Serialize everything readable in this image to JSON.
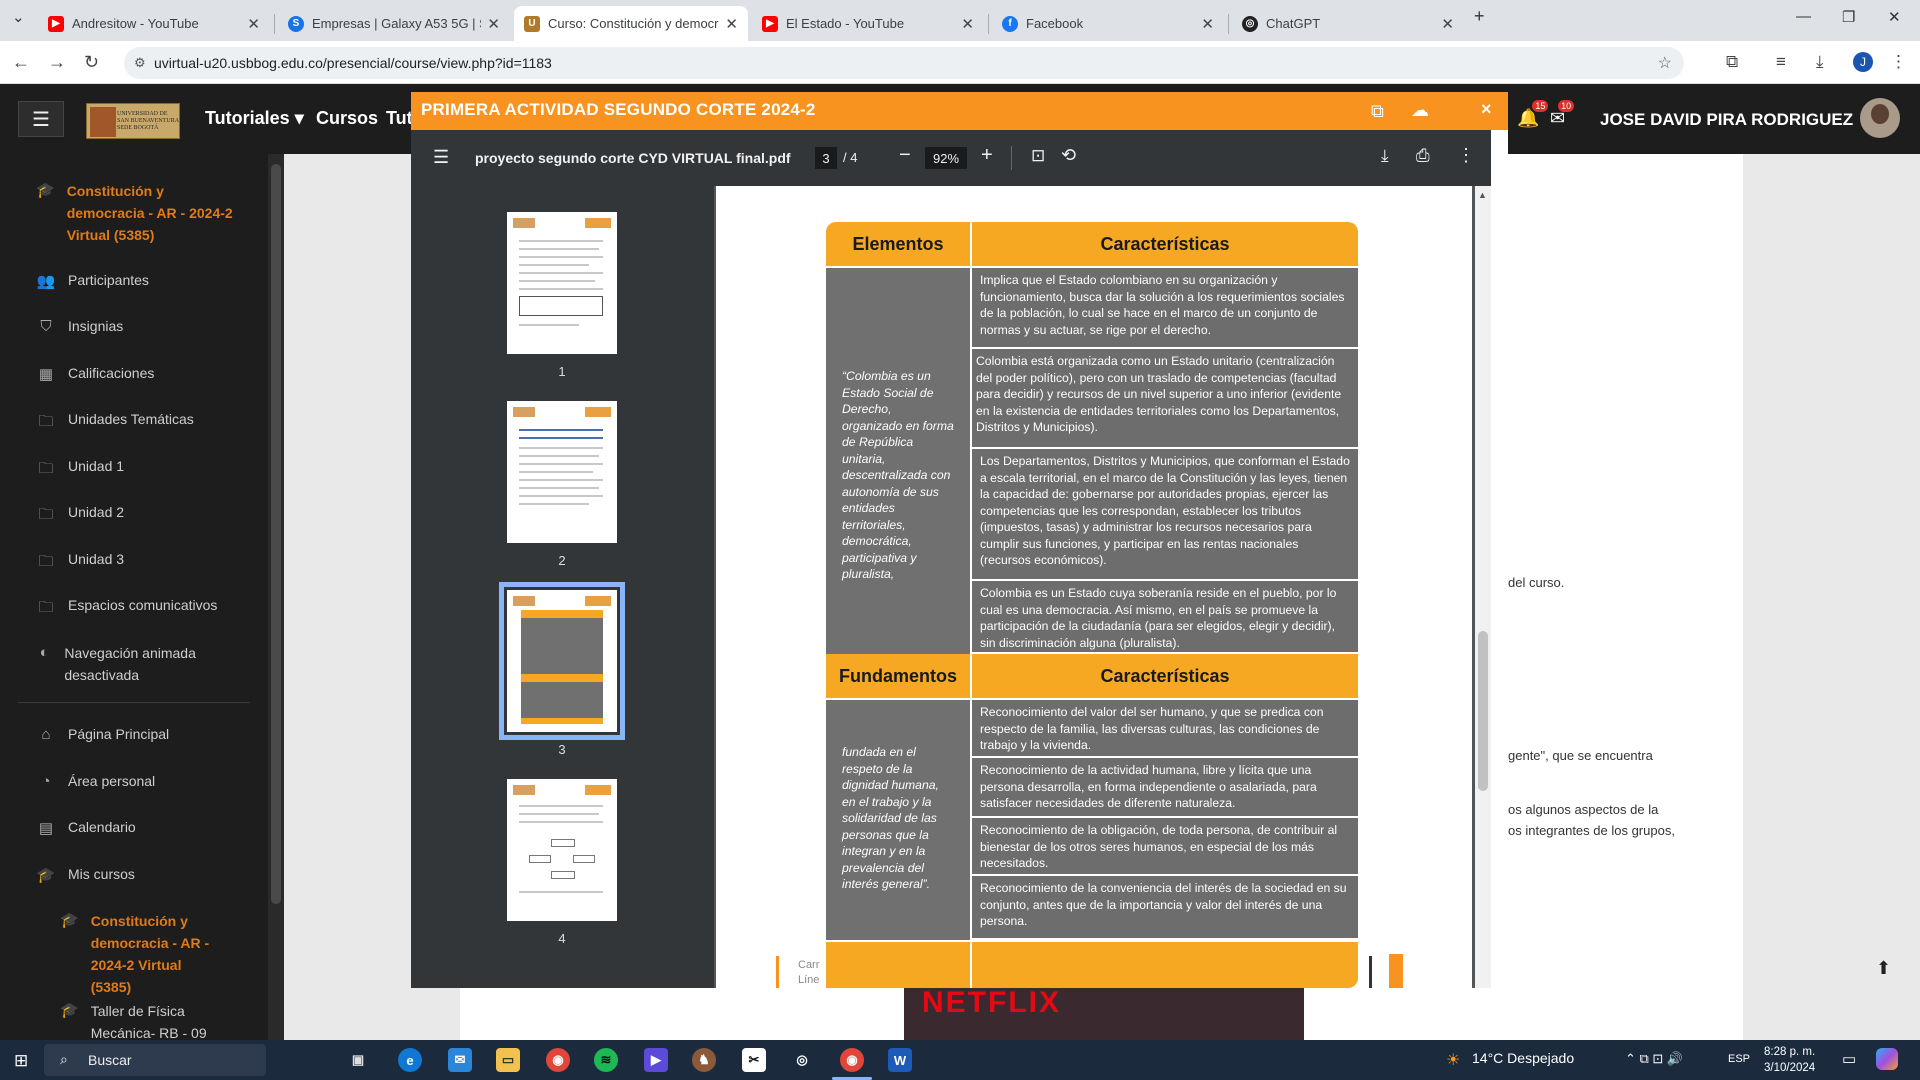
{
  "browser": {
    "tabs": [
      {
        "title": "Andresitow - YouTube",
        "favicon": "youtube-icon",
        "active": false
      },
      {
        "title": "Empresas | Galaxy A53 5G | SM-",
        "favicon": "samsung-icon",
        "active": false
      },
      {
        "title": "Curso: Constitución y democrac",
        "favicon": "usb-icon",
        "active": true
      },
      {
        "title": "El Estado - YouTube",
        "favicon": "youtube-icon",
        "active": false
      },
      {
        "title": "Facebook",
        "favicon": "facebook-icon",
        "active": false
      },
      {
        "title": "ChatGPT",
        "favicon": "chatgpt-icon",
        "active": false
      }
    ],
    "url": "uvirtual-u20.usbbog.edu.co/presencial/course/view.php?id=1183",
    "profile_initial": "J"
  },
  "site": {
    "logo_text": "UNIVERSIDAD DE SAN BUENAVENTURA SEDE BOGOTÁ",
    "nav": [
      "Tutoriales",
      "Cursos",
      "Tut"
    ],
    "notifications_count": "15",
    "messages_count": "10",
    "user_name": "JOSE DAVID PIRA RODRIGUEZ"
  },
  "sidebar": {
    "course_title": "Constitución y democracia - AR - 2024-2 Virtual (5385)",
    "items": [
      {
        "label": "Participantes",
        "icon": "users-icon"
      },
      {
        "label": "Insignias",
        "icon": "shield-icon"
      },
      {
        "label": "Calificaciones",
        "icon": "table-icon"
      },
      {
        "label": "Unidades Temáticas",
        "icon": "folder-icon"
      },
      {
        "label": "Unidad 1",
        "icon": "folder-icon"
      },
      {
        "label": "Unidad 2",
        "icon": "folder-icon"
      },
      {
        "label": "Unidad 3",
        "icon": "folder-icon"
      },
      {
        "label": "Espacios comunicativos",
        "icon": "folder-icon"
      },
      {
        "label": "Navegación animada desactivada",
        "icon": "toggle-icon"
      },
      {
        "label": "Página Principal",
        "icon": "home-icon"
      },
      {
        "label": "Área personal",
        "icon": "dashboard-icon"
      },
      {
        "label": "Calendario",
        "icon": "calendar-icon"
      },
      {
        "label": "Mis cursos",
        "icon": "graduation-cap-icon"
      }
    ],
    "my_courses": [
      {
        "label": "Constitución y democracia - AR - 2024-2 Virtual (5385)"
      },
      {
        "label": "Taller de Física Mecánica- RB - 09"
      }
    ]
  },
  "background": {
    "text1": "del curso.",
    "text2": "gente\", que se  encuentra",
    "text3": "os algunos aspectos de la",
    "text4": "os integrantes de los grupos,",
    "banner": "NETFLIX"
  },
  "modal": {
    "title": "PRIMERA ACTIVIDAD SEGUNDO CORTE 2024-2",
    "close": "×"
  },
  "pdf": {
    "filename": "proyecto segundo corte CYD VIRTUAL final.pdf",
    "current_page": "3",
    "page_of": "/   4",
    "zoom": "92%",
    "thumbnails": [
      "1",
      "2",
      "3",
      "4"
    ],
    "selected_page": 3
  },
  "document": {
    "header1_left": "Elementos",
    "header1_right": "Características",
    "quote1": "“Colombia es un Estado Social de Derecho, organizado en forma de República unitaria, descentralizada con autonomía de sus entidades territoriales, democrática, participativa y pluralista,",
    "rows1": [
      "Implica que el Estado colombiano en su organización y funcionamiento,  busca dar la solución a los requerimientos sociales de la población, lo cual se hace en el marco de un conjunto de normas y su actuar, se rige por el derecho.",
      "Colombia está organizada como un Estado unitario (centralización del poder político), pero con un traslado de competencias (facultad para decidir) y recursos de un nivel superior a uno inferior (evidente en la existencia de entidades territoriales como los Departamentos, Distritos y Municipios).",
      "Los Departamentos, Distritos y Municipios, que conforman el Estado a escala territorial, en el marco de la Constitución y las leyes, tienen la capacidad de: gobernarse por autoridades propias, ejercer las competencias que les correspondan, establecer los tributos (impuestos, tasas) y administrar los recursos necesarios para cumplir sus funciones, y participar en las rentas nacionales (recursos económicos).",
      "Colombia es un Estado cuya soberanía reside en el pueblo, por lo cual es una democracia. Así mismo, en el país se promueve la participación de la ciudadanía (para ser elegidos, elegir y decidir), sin discriminación alguna (pluralista)."
    ],
    "header2_left": "Fundamentos",
    "header2_right": "Características",
    "quote2": "fundada en el respeto de la dignidad humana, en el trabajo y la solidaridad de las personas que la integran y en la prevalencia del interés general”.",
    "rows2": [
      "Reconocimiento del valor del ser humano, y que se predica con respecto de la familia, las diversas culturas, las condiciones de trabajo y la vivienda.",
      "Reconocimiento de la actividad humana, libre y lícita que una persona desarrolla, en forma independiente o asalariada, para satisfacer necesidades de diferente naturaleza.",
      "Reconocimiento de la obligación, de toda persona, de contribuir al bienestar de los otros seres humanos, en especial de los más necesitados.",
      "Reconocimiento de la conveniencia del interés de la sociedad en su conjunto, antes que de la importancia y valor del interés de una persona."
    ],
    "footer_text": "Carr\nLíne",
    "accent_color": "#f7a823"
  },
  "taskbar": {
    "search_label": "Buscar",
    "weather": "14°C  Despejado",
    "language": "ESP",
    "time": "8:28 p. m.",
    "date": "3/10/2024"
  }
}
